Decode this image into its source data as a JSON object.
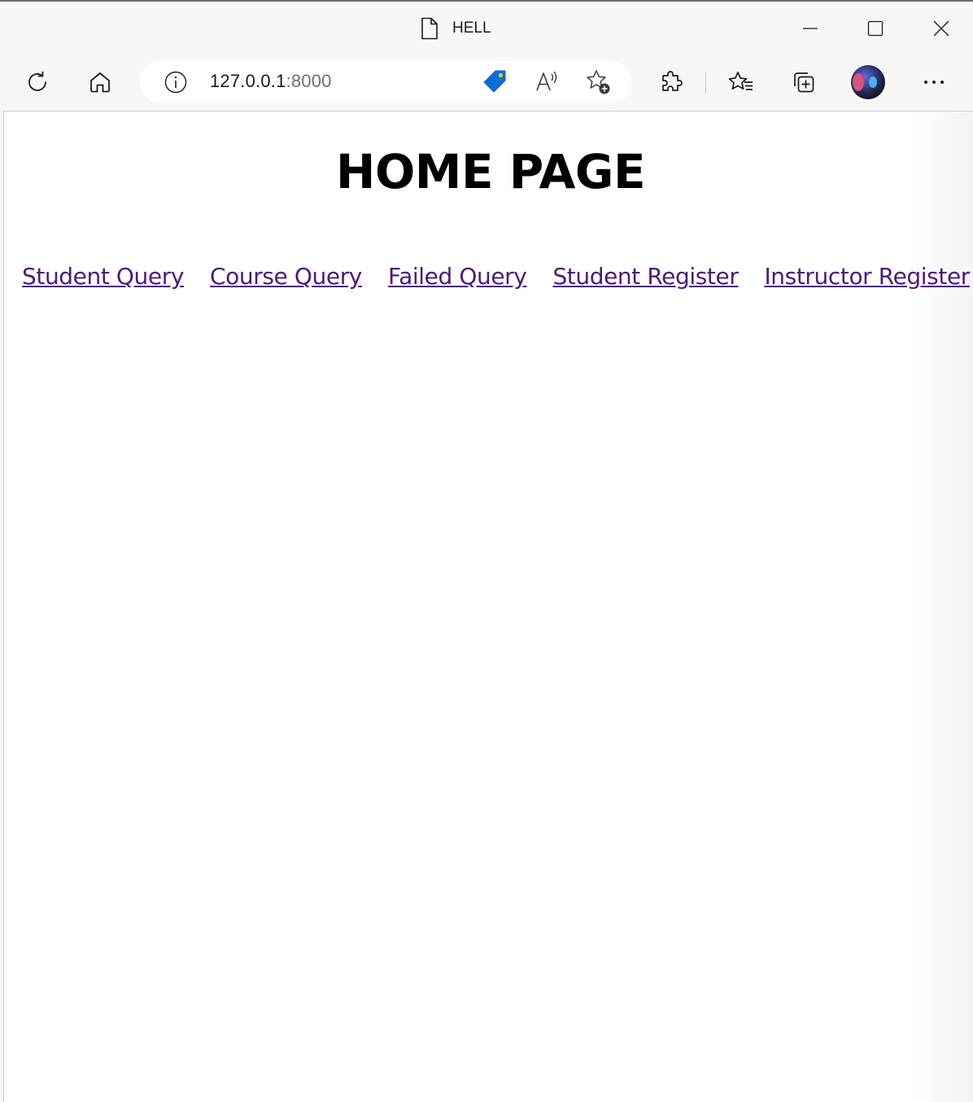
{
  "browser": {
    "tab_title": "HELL",
    "url_host": "127.0.0.1",
    "url_port": ":8000"
  },
  "page": {
    "heading": "HOME PAGE",
    "nav_links": [
      {
        "label": "Student Query"
      },
      {
        "label": "Course Query"
      },
      {
        "label": "Failed Query"
      },
      {
        "label": "Student Register"
      },
      {
        "label": "Instructor Register"
      }
    ]
  },
  "colors": {
    "link_visited": "#4d1a7f",
    "shopping_tag": "#0a6fd4",
    "chrome_background": "#f7f7f7"
  },
  "icons": {
    "tab": "page-icon",
    "window": [
      "minimize-icon",
      "maximize-icon",
      "close-icon"
    ],
    "toolbar": [
      "refresh-icon",
      "home-icon",
      "info-icon",
      "shopping-tag-icon",
      "read-aloud-icon",
      "add-favorite-icon",
      "extensions-icon",
      "favorites-icon",
      "collections-icon",
      "profile-avatar",
      "more-icon"
    ]
  }
}
